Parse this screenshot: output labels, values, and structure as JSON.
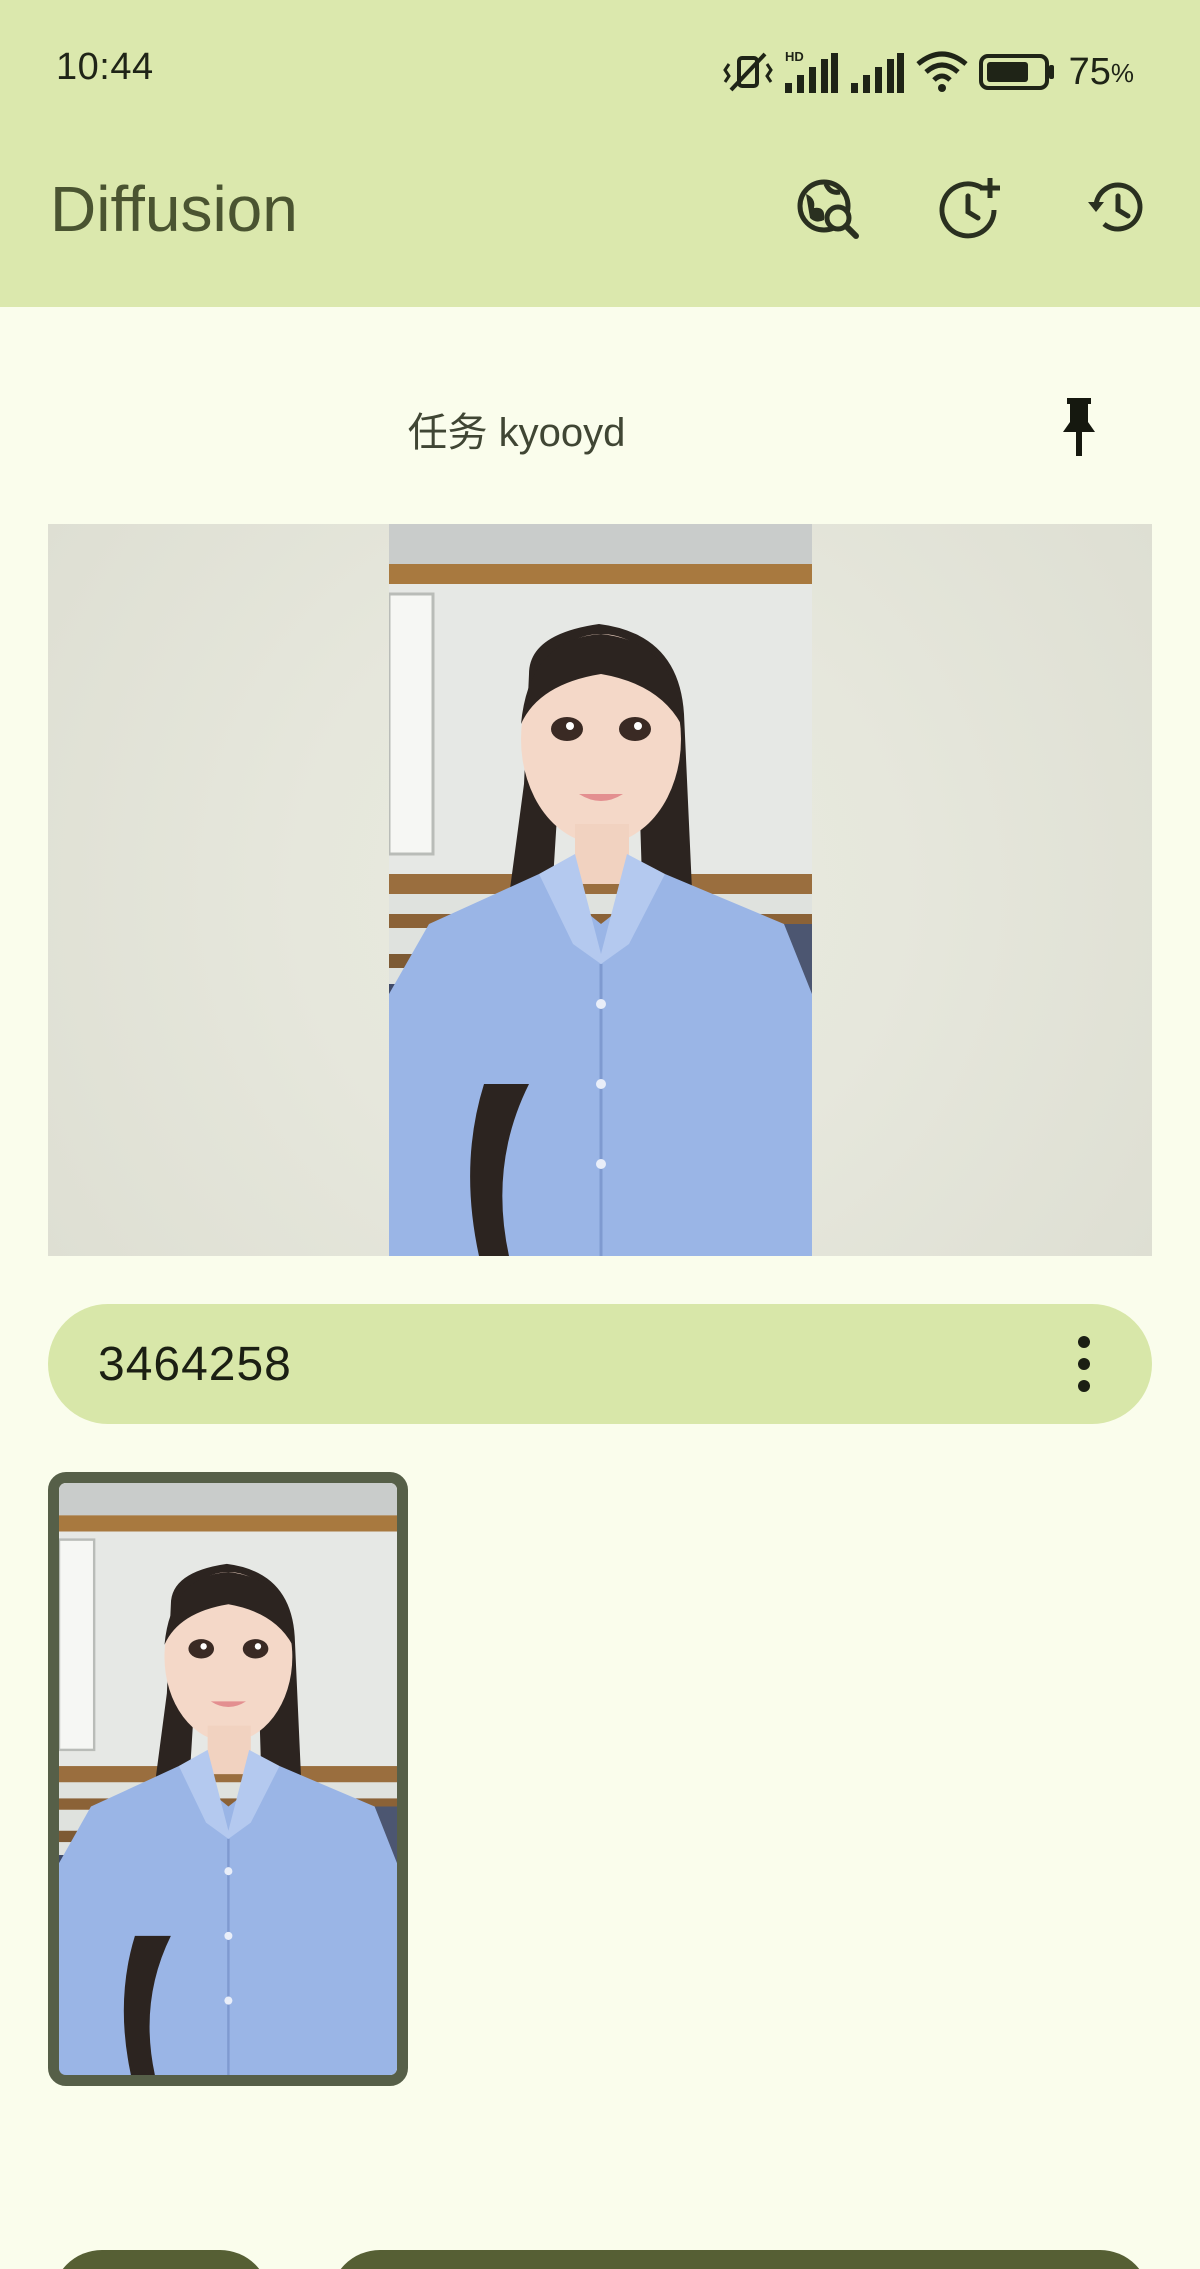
{
  "status_bar": {
    "time": "10:44",
    "hd_label": "HD",
    "battery_percent_value": "75",
    "battery_percent_sign": "%",
    "battery_level": 0.75,
    "icons": [
      "vibrate-off-icon",
      "signal-hd-icon",
      "signal-icon",
      "wifi-icon",
      "battery-icon"
    ]
  },
  "app_bar": {
    "title": "Diffusion",
    "actions": [
      "globe-search-icon",
      "clock-add-icon",
      "history-icon"
    ]
  },
  "task": {
    "title": "任务 kyooyd",
    "pin_icon": "pin-icon"
  },
  "result": {
    "seed": "3464258",
    "more_icon": "more-vert-icon"
  },
  "colors": {
    "top_bar": "#dbe8ad",
    "background": "#fafdec",
    "title": "#4a5431",
    "pill": "#d8e7a9",
    "thumb_border": "#565f48",
    "bottom_button": "#565f34"
  }
}
